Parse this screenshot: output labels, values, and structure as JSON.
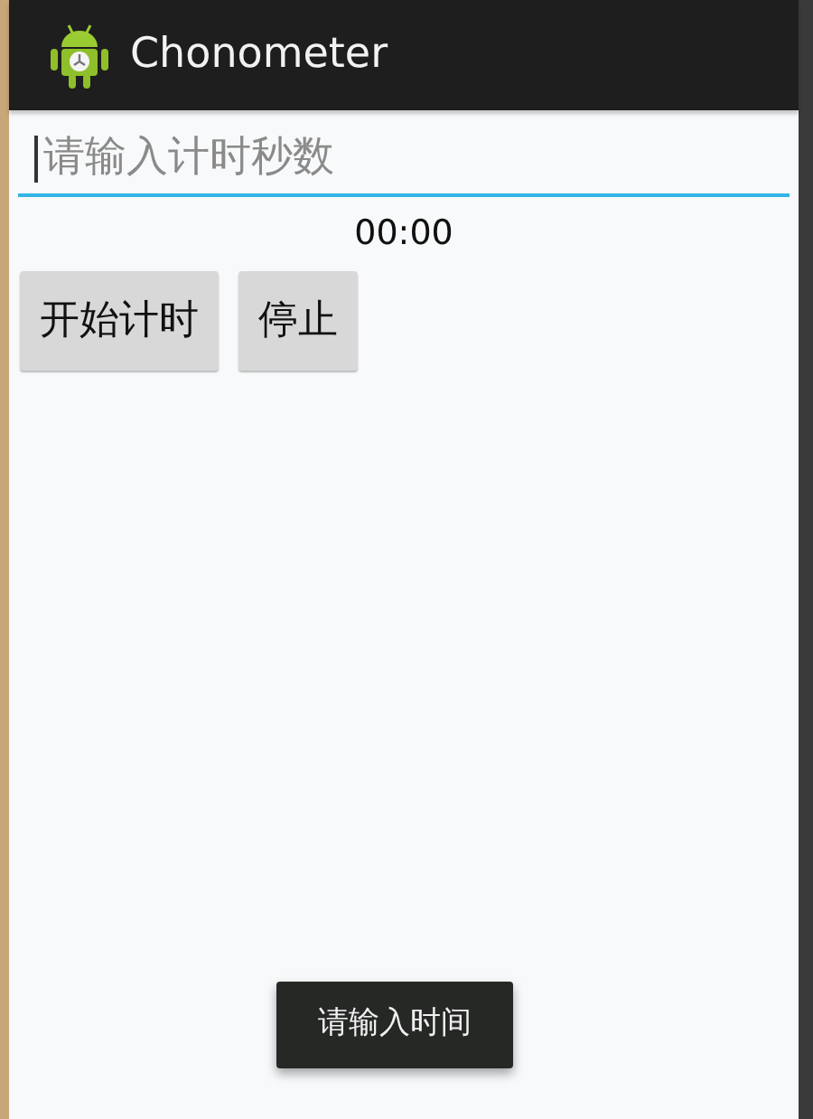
{
  "action_bar": {
    "title": "Chonometer"
  },
  "time_input": {
    "placeholder": "请输入计时秒数",
    "focused": true
  },
  "chronometer": "00:00",
  "buttons": [
    {
      "label": "开始计时"
    },
    {
      "label": "停止"
    }
  ],
  "toast": "请输入时间"
}
